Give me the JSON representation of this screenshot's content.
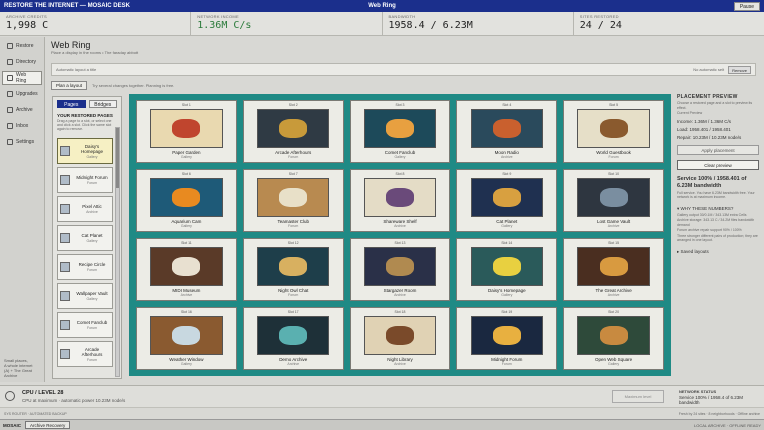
{
  "window": {
    "title": "RESTORE THE INTERNET — MOSAIC DESK",
    "center_title": "Web Ring",
    "pause_label": "Pause"
  },
  "stats": [
    {
      "label": "ARCHIVE CREDITS",
      "value": "1,998 C",
      "green": false
    },
    {
      "label": "NETWORK INCOME",
      "value": "1.36M C/s",
      "green": true
    },
    {
      "label": "BANDWIDTH",
      "value": "1958.4 / 6.23M",
      "green": false
    },
    {
      "label": "SITES RESTORED",
      "value": "24 / 24",
      "green": false
    }
  ],
  "nav": {
    "items": [
      {
        "label": "Restore",
        "icon": "restore-icon",
        "active": false
      },
      {
        "label": "Directory",
        "icon": "directory-icon",
        "active": false
      },
      {
        "label": "Web Ring",
        "icon": "web-ring-icon",
        "active": true
      },
      {
        "label": "Upgrades",
        "icon": "upgrades-icon",
        "active": false
      },
      {
        "label": "Archive",
        "icon": "archive-icon",
        "active": false
      },
      {
        "label": "Inbox",
        "icon": "inbox-icon",
        "active": false
      },
      {
        "label": "Settings",
        "icon": "settings-icon",
        "active": false
      }
    ],
    "footer_line1": "Small places,",
    "footer_line2": "A whole internet",
    "footer_line3": "(A) + The Great Archive"
  },
  "page": {
    "title": "Web Ring",
    "subtitle": "Place a display in the rooms • The faraday abbott",
    "filter_text": "Automatic layout a title",
    "filter_status": "No automatic selt",
    "filter_button": "Remove"
  },
  "toolbar": {
    "plan_label": "Plan a layout",
    "hint": "Try several changes together. Planning is free."
  },
  "left_panel": {
    "tabs": [
      {
        "label": "Pages",
        "active": true
      },
      {
        "label": "Bridges",
        "active": false
      }
    ],
    "title": "YOUR RESTORED PAGES",
    "hint": "Drag a page to a slot, or select one and click a slot. Click the same slot again to remove.",
    "cards": [
      {
        "name": "Daisy's Homepage",
        "type": "Gallery",
        "selected": true
      },
      {
        "name": "Midnight Forum",
        "type": "Forum",
        "selected": false
      },
      {
        "name": "Pixel Attic",
        "type": "Archive",
        "selected": false
      },
      {
        "name": "Cat Planet",
        "type": "Gallery",
        "selected": false
      },
      {
        "name": "Recipe Circle",
        "type": "Forum",
        "selected": false
      },
      {
        "name": "Wallpaper Vault",
        "type": "Gallery",
        "selected": false
      },
      {
        "name": "Comet Fanclub",
        "type": "Forum",
        "selected": false
      },
      {
        "name": "Arcade Afterhours",
        "type": "Forum",
        "selected": false
      }
    ]
  },
  "slots": [
    {
      "no": "Slot 1",
      "name": "Paper Garden",
      "type": "Gallery",
      "bg": "#e9d9b0",
      "fg": "#c0452e"
    },
    {
      "no": "Slot 2",
      "name": "Arcade Afterhours",
      "type": "Forum",
      "bg": "#2f3a44",
      "fg": "#c89a3a"
    },
    {
      "no": "Slot 3",
      "name": "Comet Fanclub",
      "type": "Gallery",
      "bg": "#1d4a5a",
      "fg": "#e8a040"
    },
    {
      "no": "Slot 4",
      "name": "Moon Radio",
      "type": "Archive",
      "bg": "#2a4a5c",
      "fg": "#c9602e"
    },
    {
      "no": "Slot 5",
      "name": "World Guestbook",
      "type": "Forum",
      "bg": "#e6dfc8",
      "fg": "#8a5a2e"
    },
    {
      "no": "Slot 6",
      "name": "Aquarium Cam",
      "type": "Gallery",
      "bg": "#1e5a78",
      "fg": "#e88a20"
    },
    {
      "no": "Slot 7",
      "name": "Teamaster Club",
      "type": "Forum",
      "bg": "#b88a50",
      "fg": "#e8e0c8"
    },
    {
      "no": "Slot 8",
      "name": "Shareware Shelf",
      "type": "Archive",
      "bg": "#e4dcc6",
      "fg": "#6a4a7a"
    },
    {
      "no": "Slot 9",
      "name": "Cat Planet",
      "type": "Gallery",
      "bg": "#1f3050",
      "fg": "#d8a040"
    },
    {
      "no": "Slot 10",
      "name": "Lost Game Vault",
      "type": "Archive",
      "bg": "#2e3640",
      "fg": "#7a8ea0"
    },
    {
      "no": "Slot 11",
      "name": "MIDI Museum",
      "type": "Archive",
      "bg": "#5a3a28",
      "fg": "#e8e0d0"
    },
    {
      "no": "Slot 12",
      "name": "Night Owl Chat",
      "type": "Forum",
      "bg": "#1e3e4a",
      "fg": "#d8b060"
    },
    {
      "no": "Slot 13",
      "name": "Stargazer Room",
      "type": "Archive",
      "bg": "#2a3048",
      "fg": "#b08a50"
    },
    {
      "no": "Slot 14",
      "name": "Daisy's Homepage",
      "type": "Gallery",
      "bg": "#2a5a5a",
      "fg": "#e8d040"
    },
    {
      "no": "Slot 15",
      "name": "The Great Archive",
      "type": "Archive",
      "bg": "#4a2e20",
      "fg": "#d89a40"
    },
    {
      "no": "Slot 16",
      "name": "Weather Window",
      "type": "Gallery",
      "bg": "#8a5a30",
      "fg": "#c8d8e0"
    },
    {
      "no": "Slot 17",
      "name": "Demo Archive",
      "type": "Archive",
      "bg": "#1e3038",
      "fg": "#5ab0b0"
    },
    {
      "no": "Slot 18",
      "name": "Night Library",
      "type": "Archive",
      "bg": "#e0d2b4",
      "fg": "#7a4a2a"
    },
    {
      "no": "Slot 19",
      "name": "Midnight Forum",
      "type": "Forum",
      "bg": "#1a2840",
      "fg": "#e8b040"
    },
    {
      "no": "Slot 20",
      "name": "Open Web Square",
      "type": "Gallery",
      "bg": "#2e4a3a",
      "fg": "#c88a40"
    }
  ],
  "preview": {
    "title": "PLACEMENT PREVIEW",
    "hint": "Choose a restored page and a slot to preview its effect.",
    "layout_label": "Current Preview",
    "income_line": "Income: 1.36M / 1.36M C/s",
    "load_line": "Load: 1958.401 / 1958.401",
    "repair_line": "Repair: 10.23M / 10.23M node/s",
    "apply_label": "Apply placement",
    "clear_label": "Clear preview",
    "service_text": "Service 100% / 1958.401 of 6.23M bandwidth",
    "service_note": "Full service. You have 6.23M bandwidth free. Your network is at maximum income.",
    "why_label": "WHY THESE NUMBERS?",
    "why_lines": [
      "Gallery output 30/0.1M / 343.13M extra Cells",
      "Archive storage: 343.13 C / 34.2M files bandwidth demand",
      "Forum archive repair support 90% / 100%",
      "Three stronger different pairs of production; they are arranged in one layout."
    ],
    "saved_label": "Saved layouts"
  },
  "statusbar": {
    "cpu_title": "CPU / LEVEL 28",
    "cpu_sub": "CPU at maximum · automatic power 10.23M node/s",
    "button_label": "Maximum level",
    "net_label": "NETWORK STATUS",
    "net_text": "Service 100% / 1958.4 of 6.23M bandwidth"
  },
  "subbar": {
    "left": "SYS ROUTER · AUTOMATED BACKUP",
    "right": "Fresh by 24 sites · 8 neighborhoods · Offline archive"
  },
  "taskbar": {
    "start": "MOSAIC",
    "task": "Archive Recovery",
    "tray": "LOCAL ARCHIVE · OFFLINE READY"
  }
}
